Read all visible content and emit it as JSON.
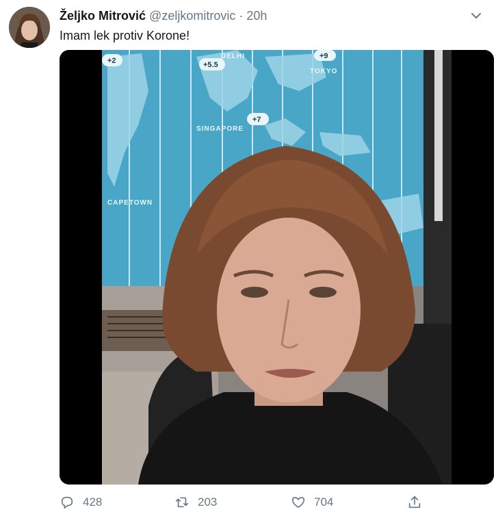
{
  "tweet": {
    "display_name": "Željko Mitrović",
    "handle": "@zeljkomitrovic",
    "separator": "·",
    "time": "20h",
    "text": "Imam lek protiv Korone!",
    "map_labels": {
      "delhi": "DELHI",
      "tokyo": "TOKYO",
      "singapore": "SINGAPORE",
      "capetown": "CAPETOWN",
      "tz_plus2": "+2",
      "tz_plus55": "+5.5",
      "tz_plus7": "+7",
      "tz_plus9": "+9"
    }
  },
  "actions": {
    "reply_count": "428",
    "retweet_count": "203",
    "like_count": "704"
  },
  "colors": {
    "icon_gray": "#657786",
    "map_blue": "#49a6c6"
  },
  "icons": [
    "chevron-down-icon",
    "reply-icon",
    "retweet-icon",
    "like-icon",
    "share-icon"
  ]
}
